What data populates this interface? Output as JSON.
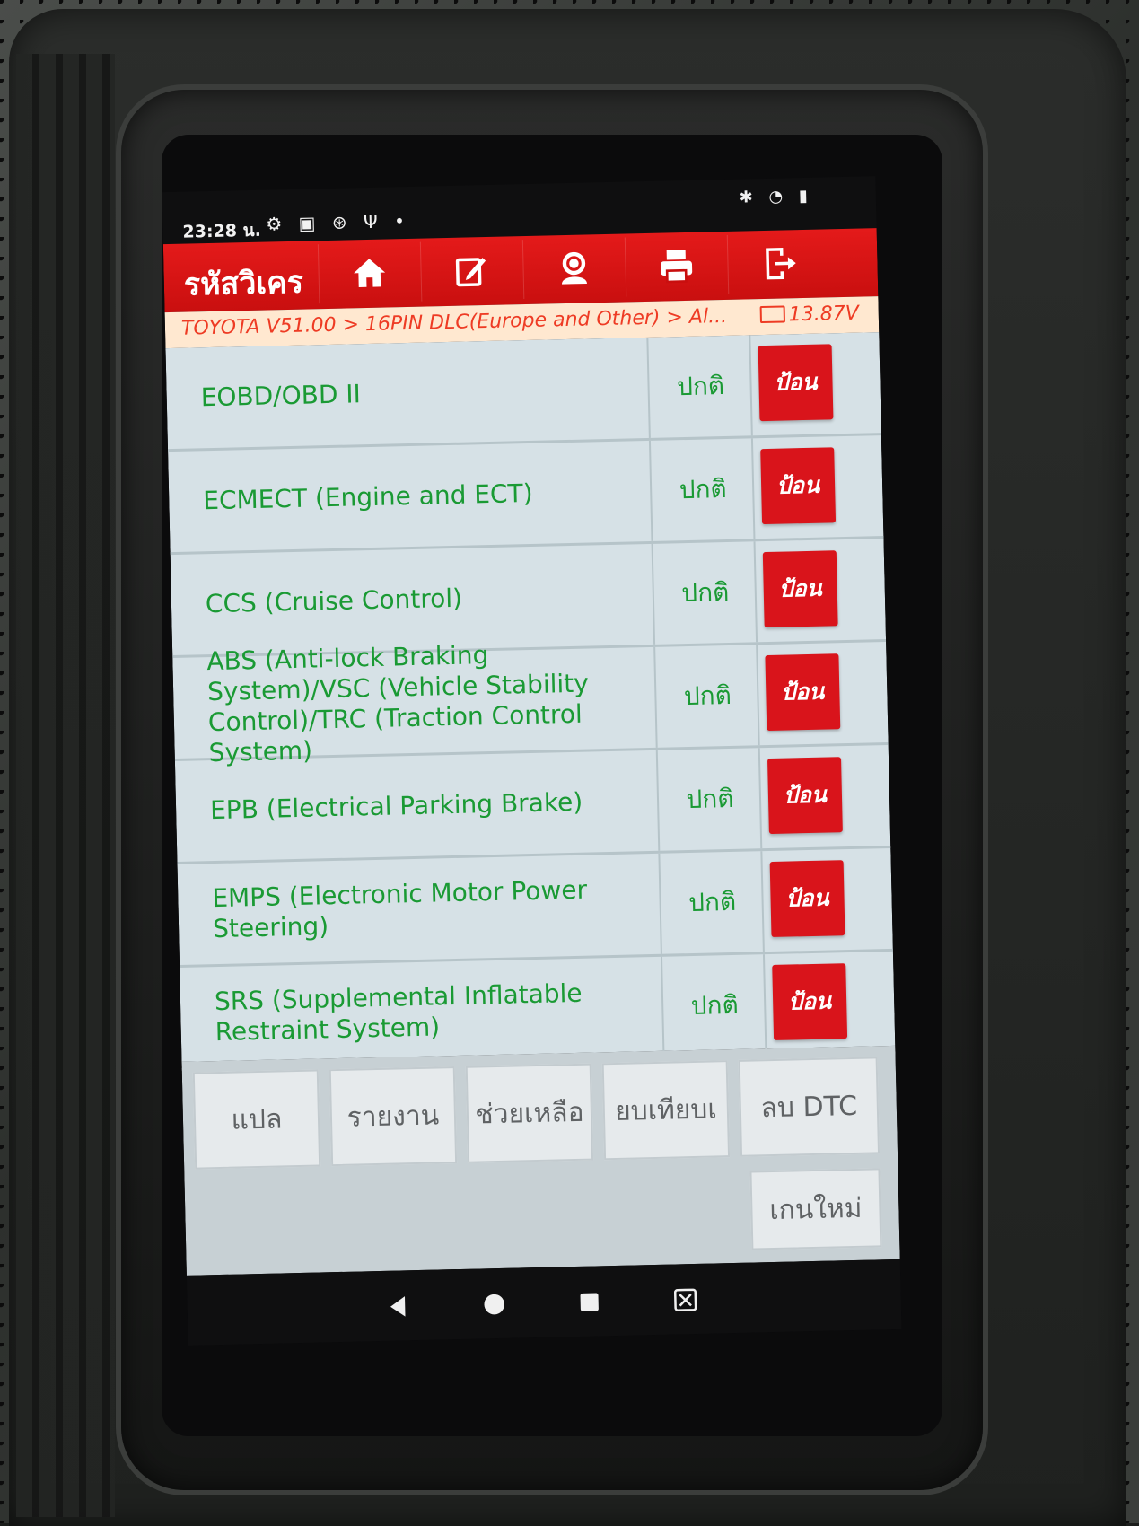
{
  "status": {
    "time": "23:28 น.",
    "icons": [
      "gear-icon",
      "photo-icon",
      "sync-icon",
      "usb-icon",
      "dot-icon"
    ],
    "right_icons": [
      "bluetooth-icon",
      "wifi-icon",
      "battery-icon"
    ]
  },
  "appbar": {
    "title": "รหัสวิเคร",
    "tools": [
      "home-icon",
      "edit-icon",
      "support-icon",
      "print-icon",
      "exit-icon"
    ],
    "color": "#d9141b"
  },
  "breadcrumb": {
    "path": "TOYOTA V51.00 > 16PIN DLC(Europe and Other) > Al...",
    "voltage": "13.87V"
  },
  "systems": [
    {
      "name": "EOBD/OBD II",
      "status": "ปกติ",
      "action": "ป้อน"
    },
    {
      "name": "ECMECT (Engine and ECT)",
      "status": "ปกติ",
      "action": "ป้อน"
    },
    {
      "name": "CCS (Cruise Control)",
      "status": "ปกติ",
      "action": "ป้อน"
    },
    {
      "name": "ABS (Anti-lock Braking System)/VSC (Vehicle Stability Control)/TRC (Traction Control System)",
      "status": "ปกติ",
      "action": "ป้อน"
    },
    {
      "name": "EPB (Electrical Parking Brake)",
      "status": "ปกติ",
      "action": "ป้อน"
    },
    {
      "name": "EMPS (Electronic Motor Power Steering)",
      "status": "ปกติ",
      "action": "ป้อน"
    },
    {
      "name": "SRS (Supplemental Inflatable Restraint System)",
      "status": "ปกติ",
      "action": "ป้อน"
    }
  ],
  "footer": {
    "translate": "แปล",
    "report": "รายงาน",
    "help": "ช่วยเหลือ",
    "compare": "ยบเทียบเ",
    "clear_dtc": "ลบ DTC",
    "rescan": "เกนใหม่"
  },
  "navbar": [
    "back-icon",
    "home-circle-icon",
    "recents-icon",
    "screenshot-icon"
  ],
  "colors": {
    "text_green": "#1a9a34",
    "crumb_text": "#ee3b24",
    "list_bg": "#d6e1e6"
  }
}
